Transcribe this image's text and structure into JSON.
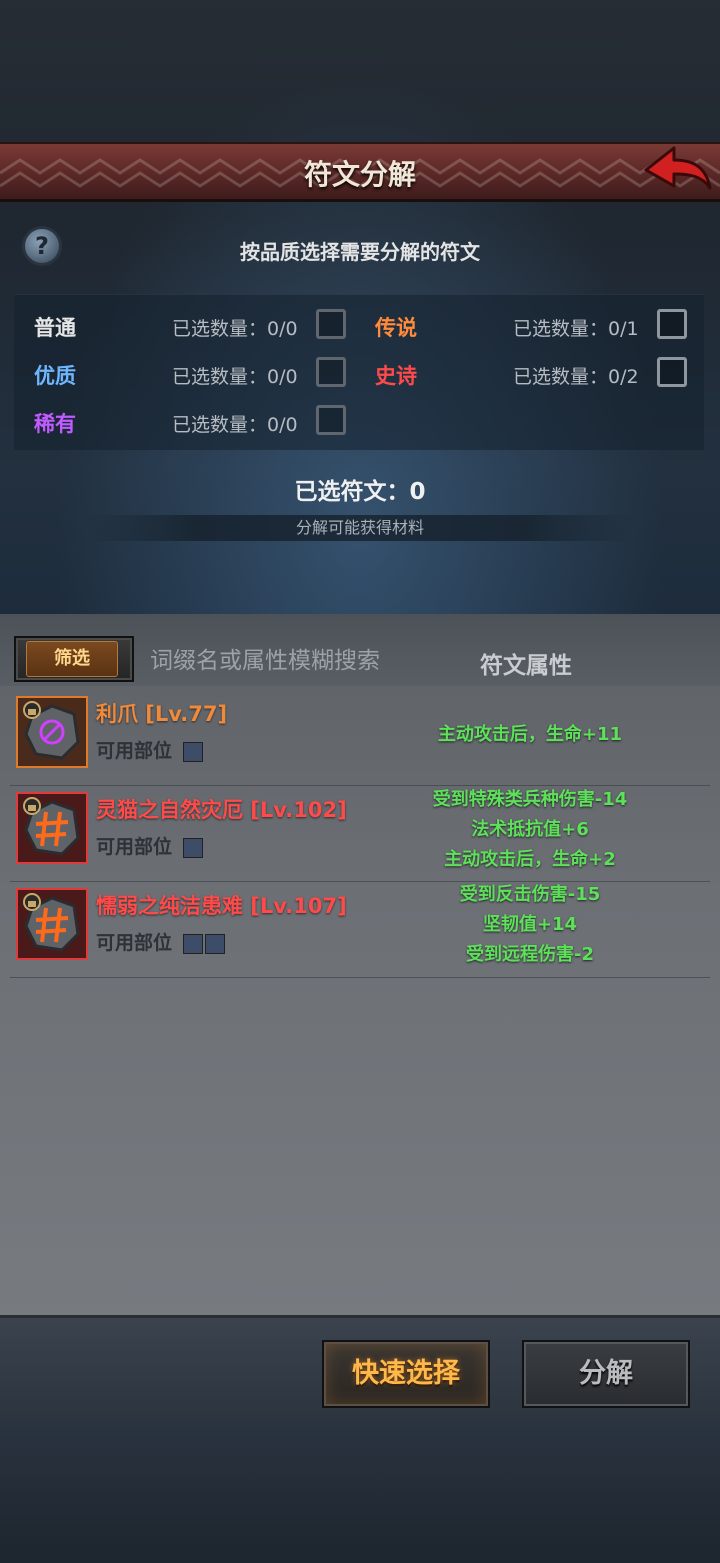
{
  "header": {
    "title": "符文分解"
  },
  "hint": "按品质选择需要分解的符文",
  "help_glyph": "?",
  "qualities": [
    {
      "name": "普通",
      "count_text": "已选数量：0/0",
      "color": "#e6e6e6"
    },
    {
      "name": "传说",
      "count_text": "已选数量：0/1",
      "color": "#ff8a3a"
    },
    {
      "name": "优质",
      "count_text": "已选数量：0/0",
      "color": "#6fb6ff"
    },
    {
      "name": "史诗",
      "count_text": "已选数量：0/2",
      "color": "#ff4a4a"
    },
    {
      "name": "稀有",
      "count_text": "已选数量：0/0",
      "color": "#c05cff"
    }
  ],
  "selected_total": "已选符文：0",
  "materials_label": "分解可能获得材料",
  "list": {
    "filter_label": "筛选",
    "search_placeholder": "词缀名或属性模糊搜索",
    "attr_header": "符文属性",
    "runes": [
      {
        "name": "利爪 [Lv.77]",
        "name_color": "#f08a3a",
        "slot_label": "可用部位",
        "attributes": [
          "主动攻击后，生命+11"
        ]
      },
      {
        "name": "灵猫之自然灾厄 [Lv.102]",
        "name_color": "#ff4a4a",
        "slot_label": "可用部位",
        "attributes": [
          "受到特殊类兵种伤害-14",
          "法术抵抗值+6",
          "主动攻击后，生命+2"
        ]
      },
      {
        "name": "懦弱之纯洁患难 [Lv.107]",
        "name_color": "#ff4a4a",
        "slot_label": "可用部位",
        "attributes": [
          "受到反击伤害-15",
          "坚韧值+14",
          "受到远程伤害-2"
        ]
      }
    ]
  },
  "buttons": {
    "quick_select": "快速选择",
    "decompose": "分解"
  },
  "colors": {
    "banner": "#5a2826",
    "attr_green": "#5ee05a",
    "back_arrow": "#d02020"
  }
}
